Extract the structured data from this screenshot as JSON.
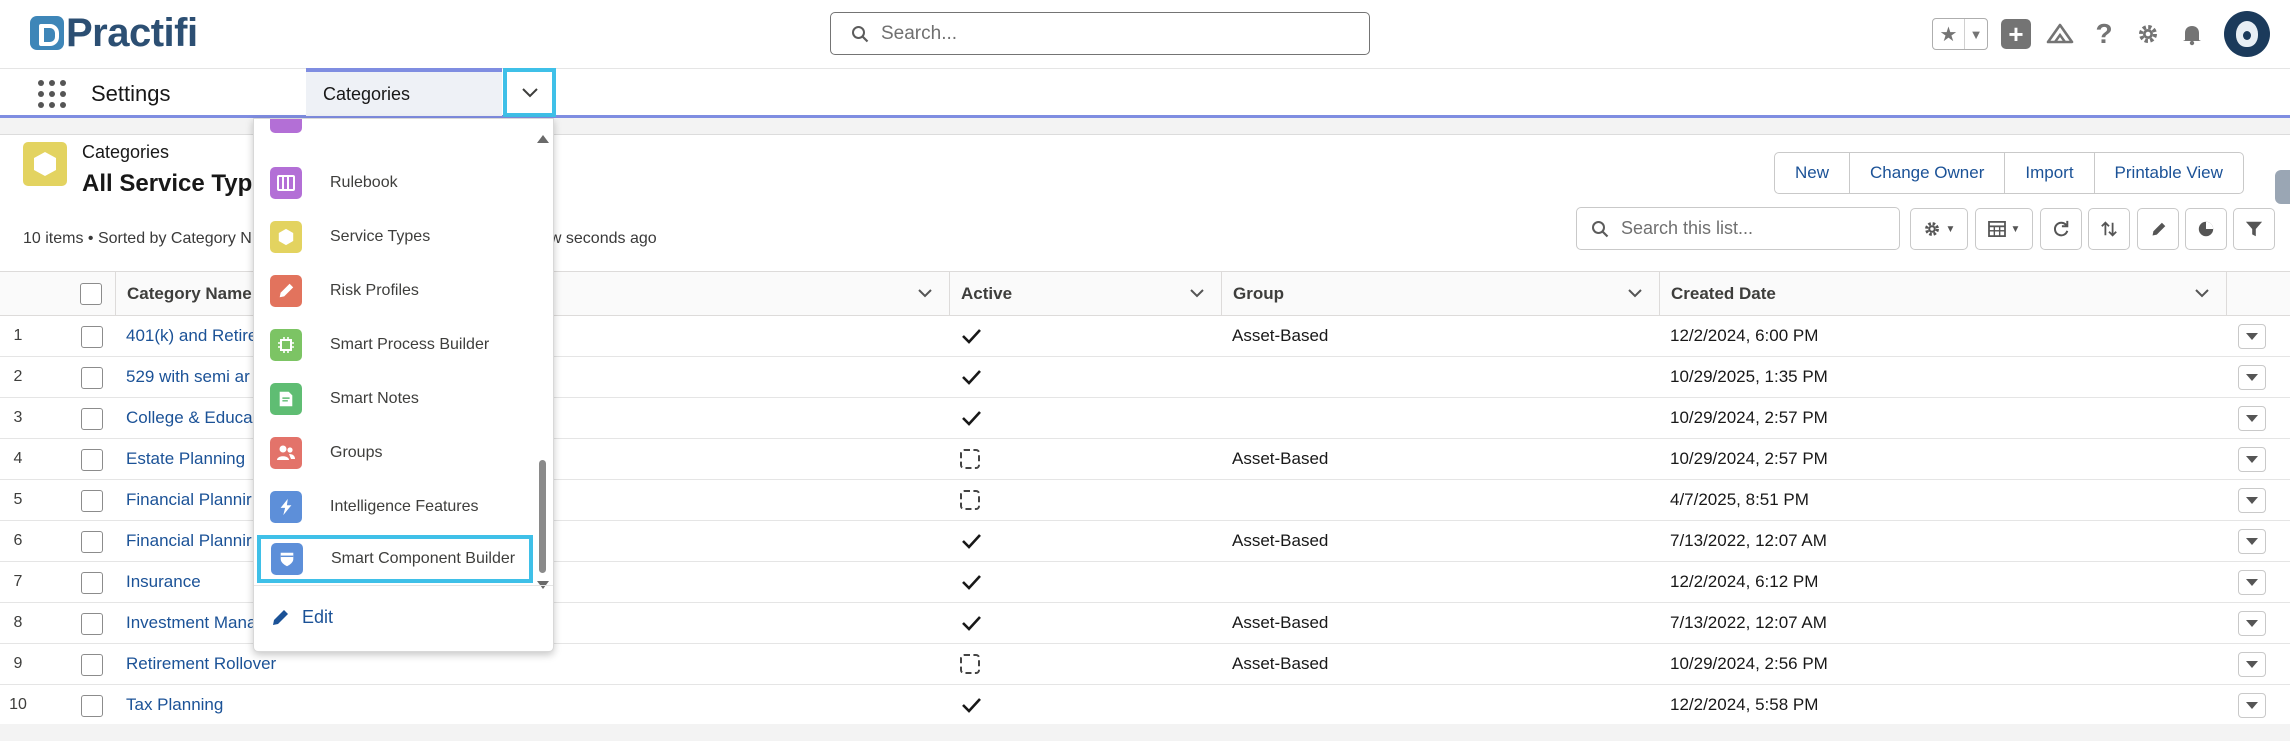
{
  "header": {
    "brand": "Practifi",
    "search_placeholder": "Search..."
  },
  "nav": {
    "app_name": "Settings",
    "active_tab": "Categories"
  },
  "list_view": {
    "object_label": "Categories",
    "title": "All Service Typ",
    "meta_left": "10 items • Sorted by Category N",
    "meta_right": "ew seconds ago",
    "buttons": [
      "New",
      "Change Owner",
      "Import",
      "Printable View"
    ],
    "search_placeholder": "Search this list..."
  },
  "table": {
    "columns": [
      "Category Name",
      "Active",
      "Group",
      "Created Date"
    ],
    "rows": [
      {
        "num": "1",
        "name": "401(k) and Retire",
        "active": true,
        "group": "Asset-Based",
        "created": "12/2/2024, 6:00 PM"
      },
      {
        "num": "2",
        "name": "529 with semi ar",
        "active": true,
        "group": "",
        "created": "10/29/2025, 1:35 PM"
      },
      {
        "num": "3",
        "name": "College & Educa",
        "active": true,
        "group": "",
        "created": "10/29/2024, 2:57 PM"
      },
      {
        "num": "4",
        "name": "Estate Planning",
        "active": false,
        "group": "Asset-Based",
        "created": "10/29/2024, 2:57 PM"
      },
      {
        "num": "5",
        "name": "Financial Plannir",
        "active": false,
        "group": "",
        "created": "4/7/2025, 8:51 PM"
      },
      {
        "num": "6",
        "name": "Financial Plannir",
        "active": true,
        "group": "Asset-Based",
        "created": "7/13/2022, 12:07 AM"
      },
      {
        "num": "7",
        "name": "Insurance",
        "active": true,
        "group": "",
        "created": "12/2/2024, 6:12 PM"
      },
      {
        "num": "8",
        "name": "Investment Mana",
        "active": true,
        "group": "Asset-Based",
        "created": "7/13/2022, 12:07 AM"
      },
      {
        "num": "9",
        "name": "Retirement Rollover",
        "active": false,
        "group": "Asset-Based",
        "created": "10/29/2024, 2:56 PM"
      },
      {
        "num": "10",
        "name": "Tax Planning",
        "active": true,
        "group": "",
        "created": "12/2/2024, 5:58 PM"
      }
    ]
  },
  "menu": {
    "items": [
      {
        "label": "Rulebook",
        "icon": "rulebook-icon",
        "color": "#b36fd6"
      },
      {
        "label": "Service Types",
        "icon": "hexagon-icon",
        "color": "#e3d360"
      },
      {
        "label": "Risk Profiles",
        "icon": "pencil-icon",
        "color": "#e2735d"
      },
      {
        "label": "Smart Process Builder",
        "icon": "chip-icon",
        "color": "#7cc464"
      },
      {
        "label": "Smart Notes",
        "icon": "note-icon",
        "color": "#5fbd73"
      },
      {
        "label": "Groups",
        "icon": "people-icon",
        "color": "#e3736a"
      },
      {
        "label": "Intelligence Features",
        "icon": "bolt-icon",
        "color": "#5d8fd9"
      },
      {
        "label": "Smart Component Builder",
        "icon": "shield-icon",
        "color": "#5d8fd9"
      }
    ],
    "edit_label": "Edit"
  },
  "colors": {
    "accent": "#7f8de1",
    "highlight": "#3fc0e8",
    "link": "#1b5297"
  }
}
